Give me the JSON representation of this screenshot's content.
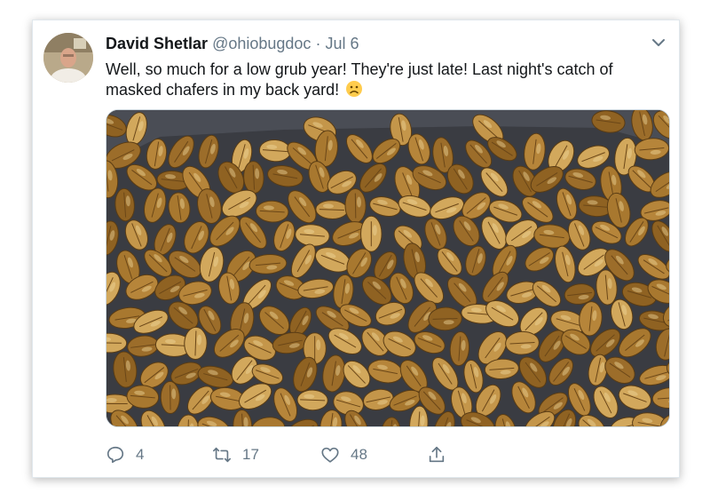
{
  "tweet": {
    "author_name": "David Shetlar",
    "handle": "@ohiobugdoc",
    "separator": "·",
    "date": "Jul 6",
    "text": "Well, so much for a low grub year! They're just late! Last night's catch of masked chafers in my back yard!",
    "emoji": "frowning-face",
    "media_icon": "photo-of-masked-chafers"
  },
  "actions": {
    "reply_icon": "reply-icon",
    "reply_count": "4",
    "retweet_icon": "retweet-icon",
    "retweet_count": "17",
    "like_icon": "heart-icon",
    "like_count": "48",
    "share_icon": "share-icon"
  },
  "colors": {
    "text": "#14171a",
    "muted": "#657786",
    "border": "#e1e8ed",
    "beetle": "#b8893f"
  }
}
